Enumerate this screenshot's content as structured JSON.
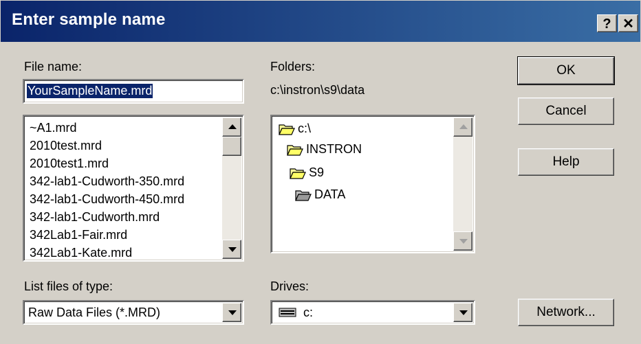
{
  "window": {
    "title": "Enter sample name",
    "help_glyph": "?",
    "close_glyph": "✕"
  },
  "file_name": {
    "label": "File name:",
    "value": "YourSampleName.mrd"
  },
  "files": [
    "~A1.mrd",
    "2010test.mrd",
    "2010test1.mrd",
    "342-lab1-Cudworth-350.mrd",
    "342-lab1-Cudworth-450.mrd",
    "342-lab1-Cudworth.mrd",
    "342Lab1-Fair.mrd",
    "342Lab1-Kate.mrd"
  ],
  "folders": {
    "label": "Folders:",
    "current_path": "c:\\instron\\s9\\data",
    "tree": [
      "c:\\",
      "INSTRON",
      "S9",
      "DATA"
    ]
  },
  "file_type": {
    "label": "List files of type:",
    "selected": "Raw Data Files (*.MRD)"
  },
  "drives": {
    "label": "Drives:",
    "selected": "c:"
  },
  "buttons": {
    "ok": "OK",
    "cancel": "Cancel",
    "help": "Help",
    "network": "Network..."
  }
}
